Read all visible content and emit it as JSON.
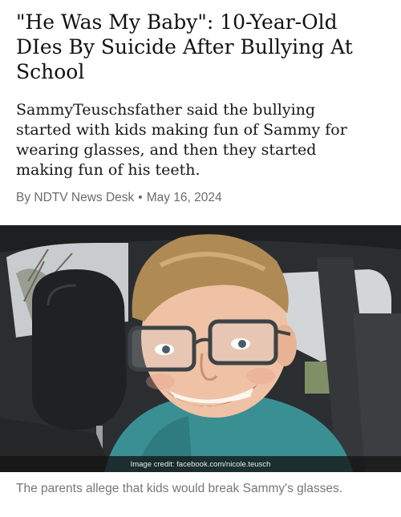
{
  "article": {
    "headline": "\"He Was My Baby\": 10-Year-Old DIes By Suicide After Bullying At School",
    "summary": "SammyTeuschsfather said the bullying started with kids making fun of Sammy for wearing glasses, and then they started making fun of his teeth.",
    "byline": {
      "author": "By NDTV News Desk",
      "separator": "•",
      "date": "May 16, 2024"
    },
    "image": {
      "credit": "Image credit: facebook.com/nicole.teusch",
      "caption": "The parents allege that kids would break Sammy's glasses."
    }
  }
}
